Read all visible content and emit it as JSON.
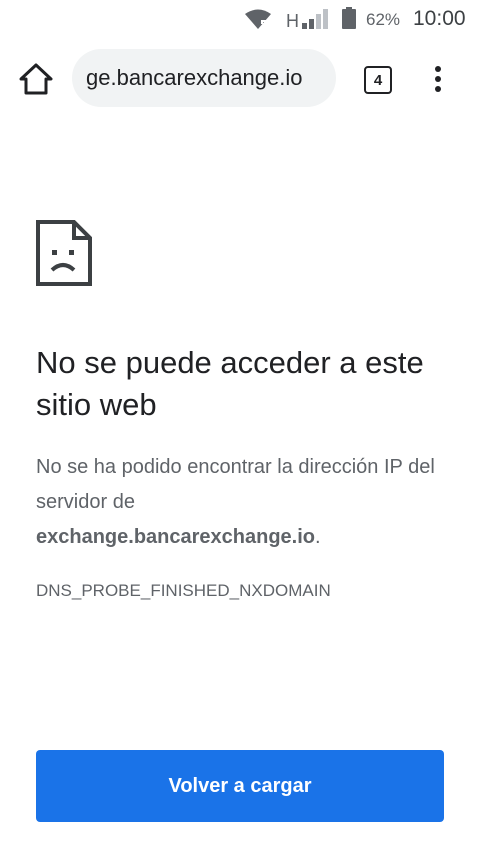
{
  "status_bar": {
    "network_type": "H",
    "battery_percent": "62%",
    "time": "10:00"
  },
  "toolbar": {
    "url": "ge.bancarexchange.io",
    "tab_count": "4",
    "icons": [
      "home-icon",
      "tab-switcher-icon",
      "more-vert-icon"
    ]
  },
  "error_page": {
    "icon": "sad-page-icon",
    "title": "No se puede acceder a este sitio web",
    "description_prefix": "No se ha podido encontrar la dirección IP del servidor de ",
    "host": "exchange.bancarexchange.io",
    "description_suffix": ".",
    "error_code": "DNS_PROBE_FINISHED_NXDOMAIN",
    "reload_label": "Volver a cargar"
  },
  "colors": {
    "accent": "#1a73e8",
    "text_primary": "#202124",
    "text_secondary": "#5f6368",
    "url_pill_bg": "#f1f3f4"
  }
}
